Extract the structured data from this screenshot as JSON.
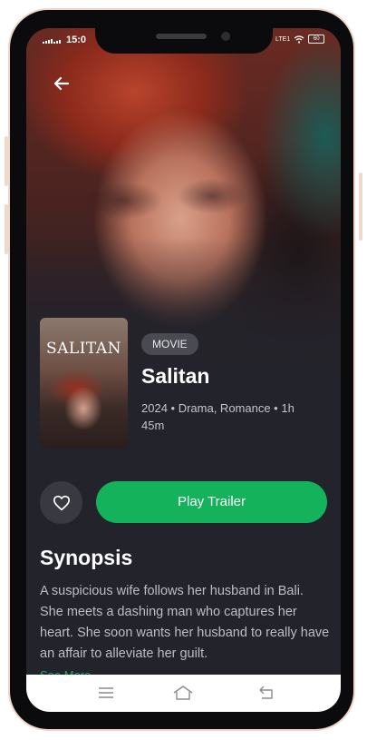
{
  "status_bar": {
    "time": "15:0",
    "network": "LTE1",
    "battery": "60"
  },
  "poster": {
    "title": "SALITAN"
  },
  "movie": {
    "badge": "MOVIE",
    "title": "Salitan",
    "meta": "2024 • Drama, Romance • 1h 45m"
  },
  "actions": {
    "play_label": "Play Trailer"
  },
  "synopsis": {
    "heading": "Synopsis",
    "text": "A suspicious wife follows her husband in Bali. She meets a dashing man who captures her heart. She soon wants her husband to really have an affair to alleviate her guilt.",
    "see_more": "See More"
  },
  "icons": {
    "back": "arrow-left-icon",
    "favorite": "heart-icon",
    "nav_menu": "menu-icon",
    "nav_home": "home-icon",
    "nav_back": "return-icon"
  },
  "colors": {
    "accent": "#14b25a",
    "background": "#23232b",
    "badge_bg": "#4a4a52"
  }
}
